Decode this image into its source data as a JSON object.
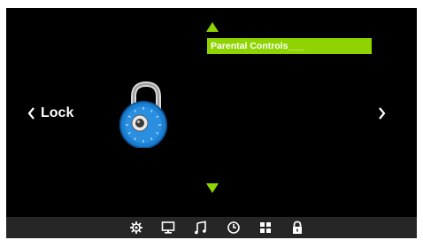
{
  "section": {
    "title": "Lock"
  },
  "menu": {
    "items": [
      {
        "label": "Parental Controls___",
        "selected": true
      }
    ]
  },
  "colors": {
    "accent": "#8fd400",
    "background": "#000000",
    "bottom_bar": "#262626",
    "lock_blue": "#1c7fd1"
  },
  "bottom_bar": {
    "icons": [
      "settings-gear-icon",
      "monitor-icon",
      "music-note-icon",
      "clock-icon",
      "apps-grid-icon",
      "padlock-icon"
    ],
    "active_icon": "padlock-icon"
  },
  "icons": {
    "left_nav": "chevron-left-icon",
    "right_nav": "chevron-right-icon",
    "up": "triangle-up-icon",
    "down": "triangle-down-icon",
    "main_image": "combination-lock-icon"
  }
}
